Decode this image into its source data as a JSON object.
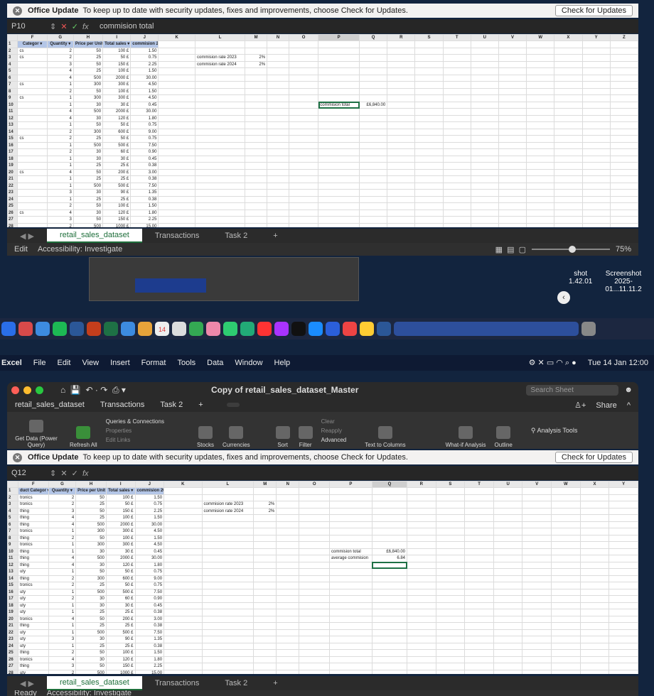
{
  "top": {
    "notice": {
      "title": "Office Update",
      "text": "To keep up to date with security updates, fixes and improvements, choose Check for Updates.",
      "button": "Check for Updates"
    },
    "name_box": "P10",
    "formula": "commision total",
    "columns": [
      "",
      "F",
      "G",
      "H",
      "I",
      "J",
      "K",
      "L",
      "M",
      "N",
      "O",
      "P",
      "Q",
      "R",
      "S",
      "T",
      "U",
      "V",
      "W",
      "X",
      "Y",
      "Z"
    ],
    "headers": [
      "Categor",
      "Quantity",
      "Price per Unit",
      "Total sales",
      "commision 2023"
    ],
    "rows": [
      {
        "n": "1",
        "c": "",
        "q": "",
        "p": "",
        "t": "",
        "m": ""
      },
      {
        "n": "2",
        "c": "cs",
        "q": "2",
        "p": "50",
        "t": "100",
        "m": "1.50"
      },
      {
        "n": "3",
        "c": "cs",
        "q": "2",
        "p": "25",
        "t": "50",
        "m": "0.75"
      },
      {
        "n": "4",
        "c": "",
        "q": "3",
        "p": "50",
        "t": "150",
        "m": "2.25"
      },
      {
        "n": "5",
        "c": "",
        "q": "4",
        "p": "25",
        "t": "100",
        "m": "1.50"
      },
      {
        "n": "6",
        "c": "",
        "q": "4",
        "p": "500",
        "t": "2000",
        "m": "30.00"
      },
      {
        "n": "7",
        "c": "cs",
        "q": "1",
        "p": "300",
        "t": "300",
        "m": "4.50"
      },
      {
        "n": "8",
        "c": "",
        "q": "2",
        "p": "50",
        "t": "100",
        "m": "1.50"
      },
      {
        "n": "9",
        "c": "cs",
        "q": "1",
        "p": "300",
        "t": "300",
        "m": "4.50"
      },
      {
        "n": "10",
        "c": "",
        "q": "1",
        "p": "30",
        "t": "30",
        "m": "0.45"
      },
      {
        "n": "11",
        "c": "",
        "q": "4",
        "p": "500",
        "t": "2000",
        "m": "30.00"
      },
      {
        "n": "12",
        "c": "",
        "q": "4",
        "p": "30",
        "t": "120",
        "m": "1.80"
      },
      {
        "n": "13",
        "c": "",
        "q": "1",
        "p": "50",
        "t": "50",
        "m": "0.75"
      },
      {
        "n": "14",
        "c": "",
        "q": "2",
        "p": "300",
        "t": "600",
        "m": "9.00"
      },
      {
        "n": "15",
        "c": "cs",
        "q": "2",
        "p": "25",
        "t": "50",
        "m": "0.75"
      },
      {
        "n": "16",
        "c": "",
        "q": "1",
        "p": "500",
        "t": "500",
        "m": "7.50"
      },
      {
        "n": "17",
        "c": "",
        "q": "2",
        "p": "30",
        "t": "60",
        "m": "0.90"
      },
      {
        "n": "18",
        "c": "",
        "q": "1",
        "p": "30",
        "t": "30",
        "m": "0.45"
      },
      {
        "n": "19",
        "c": "",
        "q": "1",
        "p": "25",
        "t": "25",
        "m": "0.38"
      },
      {
        "n": "20",
        "c": "cs",
        "q": "4",
        "p": "50",
        "t": "200",
        "m": "3.00"
      },
      {
        "n": "21",
        "c": "",
        "q": "1",
        "p": "25",
        "t": "25",
        "m": "0.38"
      },
      {
        "n": "22",
        "c": "",
        "q": "1",
        "p": "500",
        "t": "500",
        "m": "7.50"
      },
      {
        "n": "23",
        "c": "",
        "q": "3",
        "p": "30",
        "t": "90",
        "m": "1.35"
      },
      {
        "n": "24",
        "c": "",
        "q": "1",
        "p": "25",
        "t": "25",
        "m": "0.38"
      },
      {
        "n": "25",
        "c": "",
        "q": "2",
        "p": "50",
        "t": "100",
        "m": "1.50"
      },
      {
        "n": "26",
        "c": "cs",
        "q": "4",
        "p": "30",
        "t": "120",
        "m": "1.80"
      },
      {
        "n": "27",
        "c": "",
        "q": "3",
        "p": "50",
        "t": "150",
        "m": "2.25"
      },
      {
        "n": "28",
        "c": "",
        "q": "2",
        "p": "500",
        "t": "1000",
        "m": "15.00"
      }
    ],
    "side": {
      "rate2023_label": "commision rate 2023",
      "rate2023": "2%",
      "rate2024_label": "commision rate 2024",
      "rate2024": "2%",
      "total_label": "commision total",
      "total": "£6,840.00"
    },
    "tabs": [
      "retail_sales_dataset",
      "Transactions",
      "Task 2",
      "+"
    ],
    "status": {
      "mode": "Edit",
      "access": "Accessibility: Investigate",
      "zoom": "75%"
    }
  },
  "desktop": {
    "shot1": "shot",
    "shot1b": "1.42.01",
    "shot2": "Screenshot",
    "shot2b": "2025-01...11.11.2",
    "cal": "14"
  },
  "menubar": {
    "items": [
      "Excel",
      "File",
      "Edit",
      "View",
      "Insert",
      "Format",
      "Tools",
      "Data",
      "Window",
      "Help"
    ],
    "clock": "Tue 14 Jan 12:00"
  },
  "bottom": {
    "title": "Copy of retail_sales_dataset_Master",
    "search": "Search Sheet",
    "share": "Share",
    "tabs": [
      "retail_sales_dataset",
      "Transactions",
      "Task 2",
      "+"
    ],
    "ribbon": {
      "getdata": "Get Data (Power Query)",
      "refresh": "Refresh All",
      "queries": "Queries & Connections",
      "properties": "Properties",
      "editlinks": "Edit Links",
      "stocks": "Stocks",
      "currencies": "Currencies",
      "sort": "Sort",
      "filter": "Filter",
      "clear": "Clear",
      "reapply": "Reapply",
      "advanced": "Advanced",
      "texttocol": "Text to Columns",
      "whatif": "What-if Analysis",
      "outline": "Outline",
      "analysis": "Analysis Tools"
    },
    "notice": {
      "title": "Office Update",
      "text": "To keep up to date with security updates, fixes and improvements, choose Check for Updates.",
      "button": "Check for Updates"
    },
    "name_box": "Q12",
    "columns": [
      "",
      "F",
      "G",
      "H",
      "I",
      "J",
      "K",
      "L",
      "M",
      "N",
      "O",
      "P",
      "Q",
      "R",
      "S",
      "T",
      "U",
      "V",
      "W",
      "X",
      "Y"
    ],
    "headers": [
      "duct Categor",
      "Quantity",
      "Price per Unit",
      "Total sales",
      "commision 2023"
    ],
    "rows": [
      {
        "n": "1",
        "c": ""
      },
      {
        "n": "2",
        "c": "tronics"
      },
      {
        "n": "3",
        "c": "tronics"
      },
      {
        "n": "4",
        "c": "thing"
      },
      {
        "n": "5",
        "c": "thing"
      },
      {
        "n": "6",
        "c": "thing"
      },
      {
        "n": "7",
        "c": "tronics"
      },
      {
        "n": "8",
        "c": "thing"
      },
      {
        "n": "9",
        "c": "tronics"
      },
      {
        "n": "10",
        "c": "thing"
      },
      {
        "n": "11",
        "c": "thing"
      },
      {
        "n": "12",
        "c": "thing"
      },
      {
        "n": "13",
        "c": "uty"
      },
      {
        "n": "14",
        "c": "thing"
      },
      {
        "n": "15",
        "c": "tronics"
      },
      {
        "n": "16",
        "c": "uty"
      },
      {
        "n": "17",
        "c": "uty"
      },
      {
        "n": "18",
        "c": "uty"
      },
      {
        "n": "19",
        "c": "uty"
      },
      {
        "n": "20",
        "c": "tronics"
      },
      {
        "n": "21",
        "c": "thing"
      },
      {
        "n": "22",
        "c": "uty"
      },
      {
        "n": "23",
        "c": "uty"
      },
      {
        "n": "24",
        "c": "uty"
      },
      {
        "n": "25",
        "c": "thing"
      },
      {
        "n": "26",
        "c": "tronics"
      },
      {
        "n": "27",
        "c": "thing"
      },
      {
        "n": "28",
        "c": "uty"
      }
    ],
    "side": {
      "total_label": "commision total",
      "total": "£6,840.00",
      "avg_label": "average commision",
      "avg": "6.84"
    },
    "status": {
      "mode": "Ready",
      "access": "Accessibility: Investigate"
    }
  }
}
